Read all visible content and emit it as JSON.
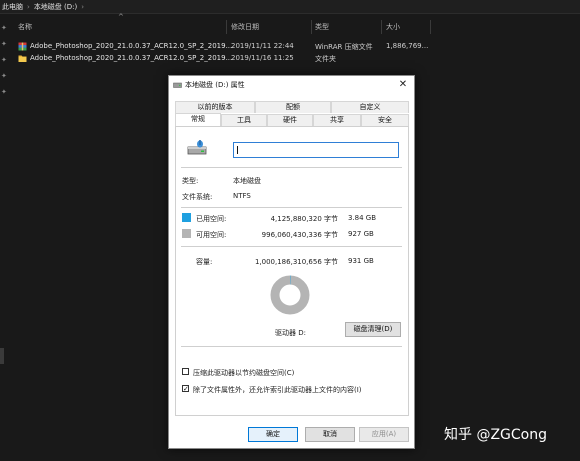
{
  "breadcrumb": {
    "root": "此电脑",
    "drive": "本地磁盘 (D:)"
  },
  "columns": {
    "name": "名称",
    "date": "修改日期",
    "type": "类型",
    "size": "大小"
  },
  "files": [
    {
      "name": "Adobe_Photoshop_2020_21.0.0.37_ACR12.0_SP_2_2019...",
      "date": "2019/11/11 22:44",
      "type": "WinRAR 压缩文件",
      "size": "1,886,769...",
      "icon": "winrar-archive-icon"
    },
    {
      "name": "Adobe_Photoshop_2020_21.0.0.37_ACR12.0_SP_2_2019...",
      "date": "2019/11/16 11:25",
      "type": "文件夹",
      "size": "",
      "icon": "folder-icon"
    }
  ],
  "dialog": {
    "title": "本地磁盘 (D:) 属性",
    "tabs_row1": [
      "以前的版本",
      "配额",
      "自定义"
    ],
    "tabs_row2": [
      "常规",
      "工具",
      "硬件",
      "共享",
      "安全"
    ],
    "active_tab": "常规",
    "volume_label_value": "",
    "type_label": "类型:",
    "type_value": "本地磁盘",
    "fs_label": "文件系统:",
    "fs_value": "NTFS",
    "used_label": "已用空间:",
    "used_bytes": "4,125,880,320 字节",
    "used_gb": "3.84 GB",
    "free_label": "可用空间:",
    "free_bytes": "996,060,430,336 字节",
    "free_gb": "927 GB",
    "capacity_label": "容量:",
    "capacity_bytes": "1,000,186,310,656 字节",
    "capacity_gb": "931 GB",
    "used_fraction": 0.0041,
    "drive_letter_label": "驱动器 D:",
    "cleanup_button": "磁盘清理(D)",
    "compress_option": "压缩此驱动器以节约磁盘空间(C)",
    "compress_checked": false,
    "index_option": "除了文件属性外，还允许索引此驱动器上文件的内容(I)",
    "index_checked": true,
    "ok": "确定",
    "cancel": "取消",
    "apply": "应用(A)"
  },
  "colors": {
    "used": "#1fa0e0",
    "free": "#b4b4b4",
    "accent": "#0078d7"
  },
  "watermark": "知乎 @ZGCong"
}
